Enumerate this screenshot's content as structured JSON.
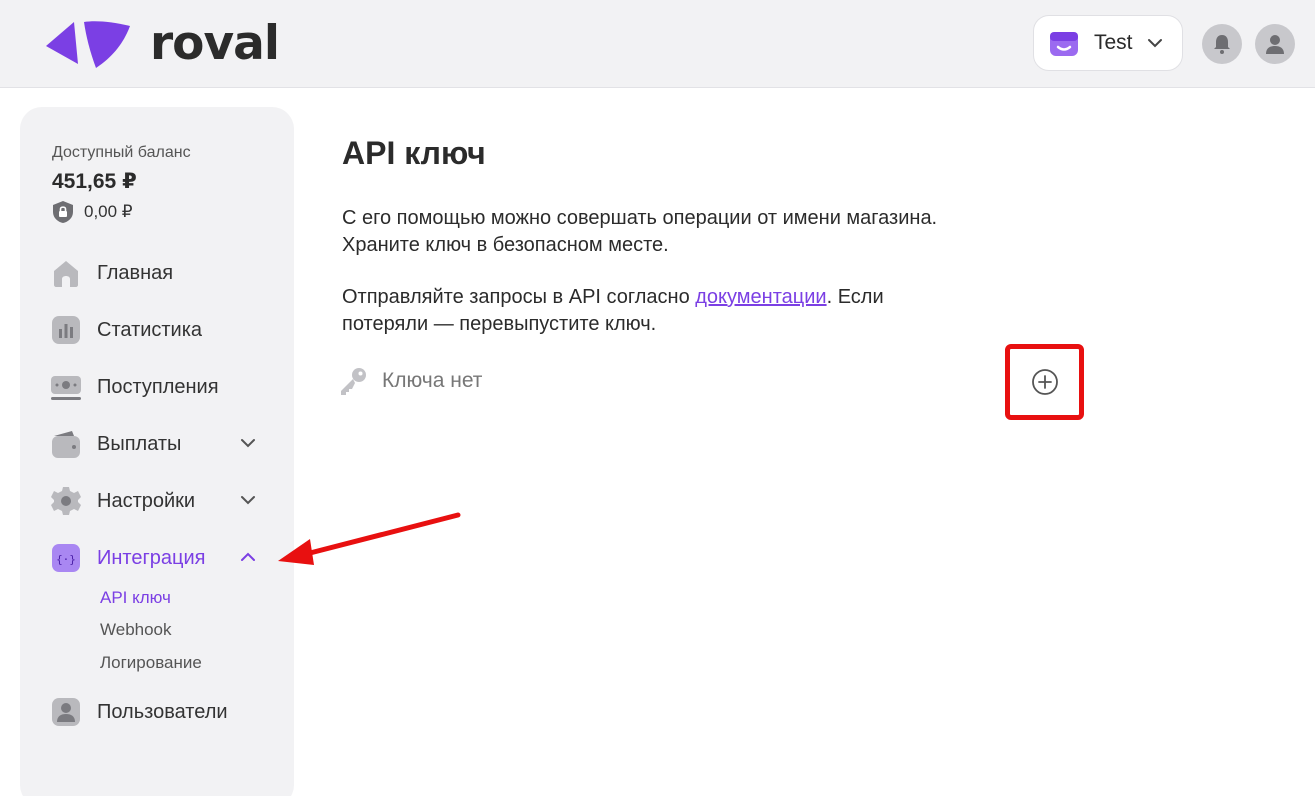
{
  "header": {
    "logo_text": "roval",
    "shop_name": "Test",
    "colors": {
      "brand": "#7b3fe4",
      "background": "#f2f2f4"
    }
  },
  "sidebar": {
    "balance_label": "Доступный баланс",
    "balance_value": "451,65 ₽",
    "hold_value": "0,00 ₽",
    "items": [
      {
        "label": "Главная",
        "icon": "home-icon"
      },
      {
        "label": "Статистика",
        "icon": "chart-icon"
      },
      {
        "label": "Поступления",
        "icon": "income-icon"
      },
      {
        "label": "Выплаты",
        "icon": "wallet-icon",
        "expandable": true
      },
      {
        "label": "Настройки",
        "icon": "gear-icon",
        "expandable": true
      },
      {
        "label": "Интеграция",
        "icon": "code-icon",
        "expandable": true,
        "expanded": true,
        "active": true
      },
      {
        "label": "Пользователи",
        "icon": "user-icon"
      }
    ],
    "integration_subitems": [
      {
        "label": "API ключ",
        "active": true
      },
      {
        "label": "Webhook"
      },
      {
        "label": "Логирование"
      }
    ]
  },
  "main": {
    "title": "API ключ",
    "para1_line1": "С его помощью можно совершать операции от имени магазина.",
    "para1_line2": "Храните ключ в безопасном месте.",
    "para2_prefix": "Отправляйте запросы в API согласно ",
    "para2_link": "документации",
    "para2_suffix": ". Если",
    "para2_line2": "потеряли — перевыпустите ключ.",
    "key_empty": "Ключа нет"
  }
}
